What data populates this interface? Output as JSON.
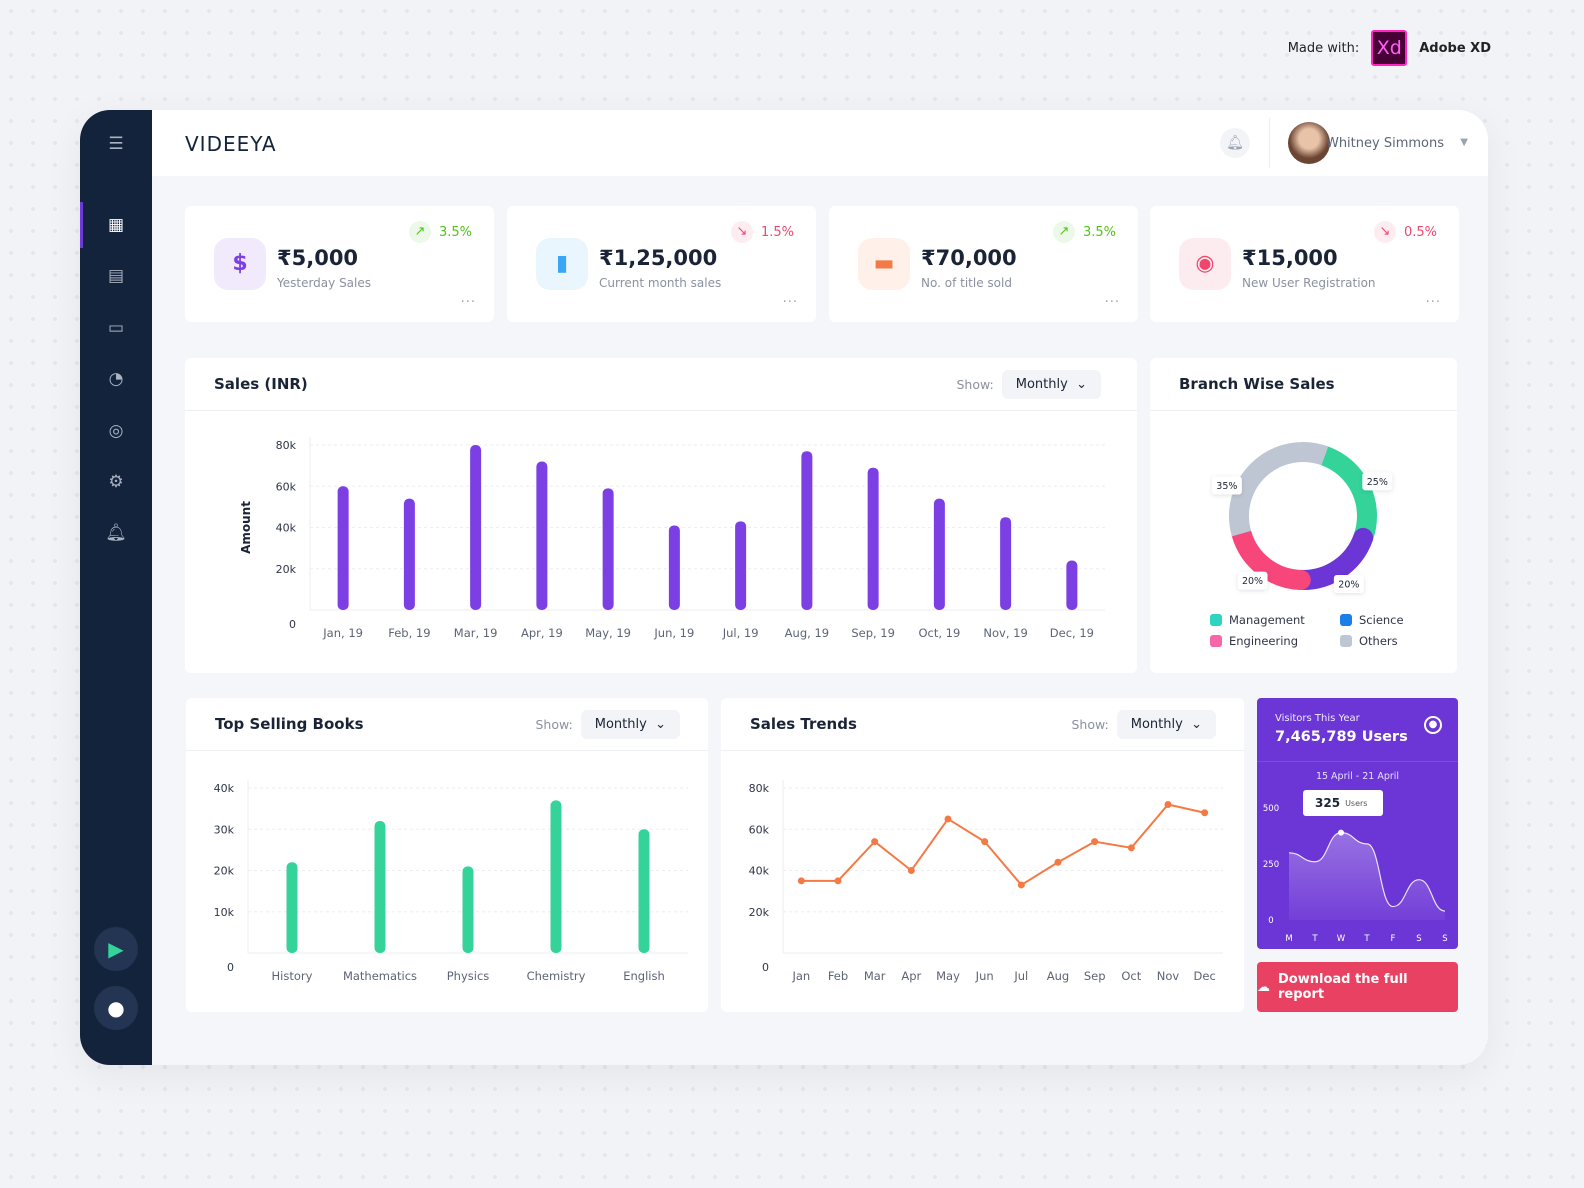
{
  "made_with": {
    "label": "Made with:",
    "logo": "Xd",
    "product": "Adobe XD"
  },
  "header": {
    "logo": "VIDEEYA",
    "user_name": "Whitney Simmons"
  },
  "sidebar": {
    "icons": [
      "menu-icon",
      "dashboard-icon",
      "inbox-icon",
      "card-icon",
      "pie-chart-icon",
      "user-icon",
      "settings-icon",
      "bell-icon"
    ],
    "stores": [
      "google-play-icon",
      "apple-icon"
    ]
  },
  "stats": [
    {
      "value": "₹5,000",
      "label": "Yesterday Sales",
      "change": "3.5%",
      "trend": "up",
      "icon": "$",
      "color": "#7b3fe4",
      "bg": "#f1eafd"
    },
    {
      "value": "₹1,25,000",
      "label": "Current month sales",
      "change": "1.5%",
      "trend": "down",
      "icon": "bar-chart-icon",
      "color": "#3aa6f5",
      "bg": "#eaf6fe"
    },
    {
      "value": "₹70,000",
      "label": "No. of title sold",
      "change": "3.5%",
      "trend": "up",
      "icon": "book-icon",
      "color": "#f47a45",
      "bg": "#fff0ea"
    },
    {
      "value": "₹15,000",
      "label": "New User Registration",
      "change": "0.5%",
      "trend": "down",
      "icon": "user-circle-icon",
      "color": "#f0466e",
      "bg": "#fdecef"
    }
  ],
  "colors": {
    "up": "#52c41a",
    "down": "#f0466e",
    "purple": "#7b3fe4",
    "green": "#34d399",
    "orange": "#f47a45"
  },
  "show_label": "Show:",
  "sales": {
    "title": "Sales (INR)",
    "period": "Monthly"
  },
  "branch": {
    "title": "Branch Wise Sales"
  },
  "books": {
    "title": "Top Selling Books",
    "period": "Monthly"
  },
  "trends": {
    "title": "Sales Trends",
    "period": "Monthly"
  },
  "visitors": {
    "title": "Visitors This Year",
    "total": "7,465,789 Users",
    "range": "15 April - 21 April",
    "tooltip_value": "325",
    "tooltip_unit": "Users"
  },
  "download": {
    "label": "Download the full report"
  },
  "chart_data": [
    {
      "type": "bar",
      "ylabel": "Amount",
      "categories": [
        "Jan, 19",
        "Feb, 19",
        "Mar, 19",
        "Apr, 19",
        "May, 19",
        "Jun, 19",
        "Jul, 19",
        "Aug, 19",
        "Sep, 19",
        "Oct, 19",
        "Nov, 19",
        "Dec, 19"
      ],
      "values": [
        60,
        54,
        80,
        72,
        59,
        41,
        43,
        77,
        69,
        54,
        45,
        24
      ],
      "yticks": [
        "0",
        "20k",
        "40k",
        "60k",
        "80k"
      ],
      "ylim": [
        0,
        80
      ],
      "color": "#7b3fe4",
      "grid": true
    },
    {
      "type": "pie",
      "donut": true,
      "slices": [
        {
          "name": "Management",
          "value": 25,
          "label": "25%",
          "color": "#34d399",
          "legend_color": "#2dd4bf"
        },
        {
          "name": "Science",
          "value": 20,
          "label": "20%",
          "color": "#6c35d6",
          "legend_color": "#1a7fe8"
        },
        {
          "name": "Engineering",
          "value": 20,
          "label": "20%",
          "color": "#f7467a",
          "legend_color": "#f767a8"
        },
        {
          "name": "Others",
          "value": 35,
          "label": "35%",
          "color": "#bfc6d3",
          "legend_color": "#bfc6d3"
        }
      ],
      "legend": "bottom"
    },
    {
      "type": "bar",
      "categories": [
        "History",
        "Mathematics",
        "Physics",
        "Chemistry",
        "English"
      ],
      "values": [
        22,
        32,
        21,
        37,
        30
      ],
      "yticks": [
        "0",
        "10k",
        "20k",
        "30k",
        "40k"
      ],
      "ylim": [
        0,
        40
      ],
      "color": "#34d399",
      "grid": true
    },
    {
      "type": "line",
      "categories": [
        "Jan",
        "Feb",
        "Mar",
        "Apr",
        "May",
        "Jun",
        "Jul",
        "Aug",
        "Sep",
        "Oct",
        "Nov",
        "Dec"
      ],
      "values": [
        35,
        35,
        54,
        40,
        65,
        54,
        33,
        44,
        54,
        51,
        72,
        68
      ],
      "yticks": [
        "0",
        "20k",
        "40k",
        "60k",
        "80k"
      ],
      "ylim": [
        0,
        80
      ],
      "color": "#f47a45",
      "grid": true
    },
    {
      "type": "area",
      "categories": [
        "M",
        "T",
        "W",
        "T",
        "F",
        "S",
        "S"
      ],
      "values": [
        300,
        260,
        390,
        340,
        60,
        180,
        40
      ],
      "yticks": [
        "0",
        "250",
        "500"
      ],
      "ylim": [
        0,
        500
      ]
    }
  ]
}
